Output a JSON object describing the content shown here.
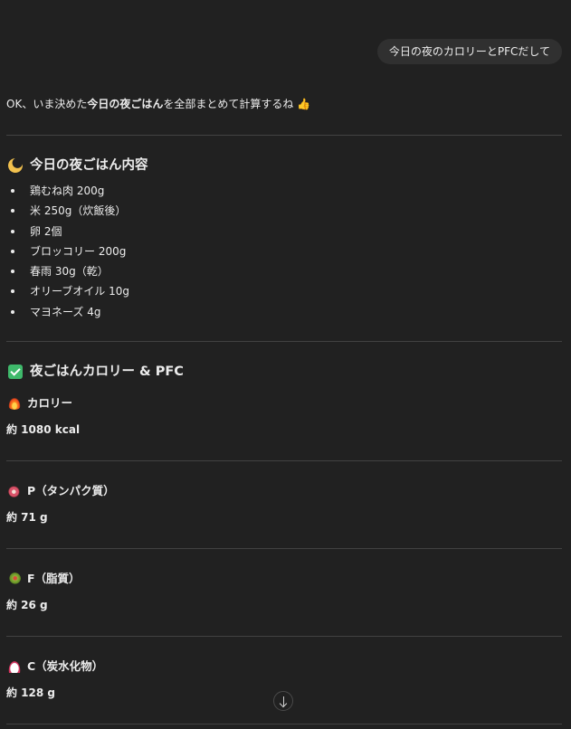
{
  "user_message": "今日の夜のカロリーとPFCだして",
  "assistant": {
    "intro_prefix": "OK、いま決めた",
    "intro_bold": "今日の夜ごはん",
    "intro_suffix": "を全部まとめて計算するね 👍",
    "section_menu": {
      "icon": "crescent-moon-icon",
      "title": "今日の夜ごはん内容",
      "items": [
        "鶏むね肉 200g",
        "米 250g（炊飯後）",
        "卵 2個",
        "ブロッコリー 200g",
        "春雨 30g（乾）",
        "オリーブオイル 10g",
        "マヨネーズ 4g"
      ]
    },
    "section_totals": {
      "icon": "check-mark-button-icon",
      "title": "夜ごはんカロリー & PFC",
      "calorie": {
        "icon": "fire-icon",
        "label": "カロリー",
        "value": "約 1080 kcal"
      },
      "protein": {
        "icon": "meat-icon",
        "label": "P（タンパク質）",
        "value": "約 71 g"
      },
      "fat": {
        "icon": "olive-icon",
        "label": "F（脂質）",
        "value": "約 26 g"
      },
      "carb": {
        "icon": "rice-icon",
        "label": "C（炭水化物）",
        "value": "約 128 g"
      }
    }
  },
  "scroll_button_icon": "arrow-down-icon"
}
